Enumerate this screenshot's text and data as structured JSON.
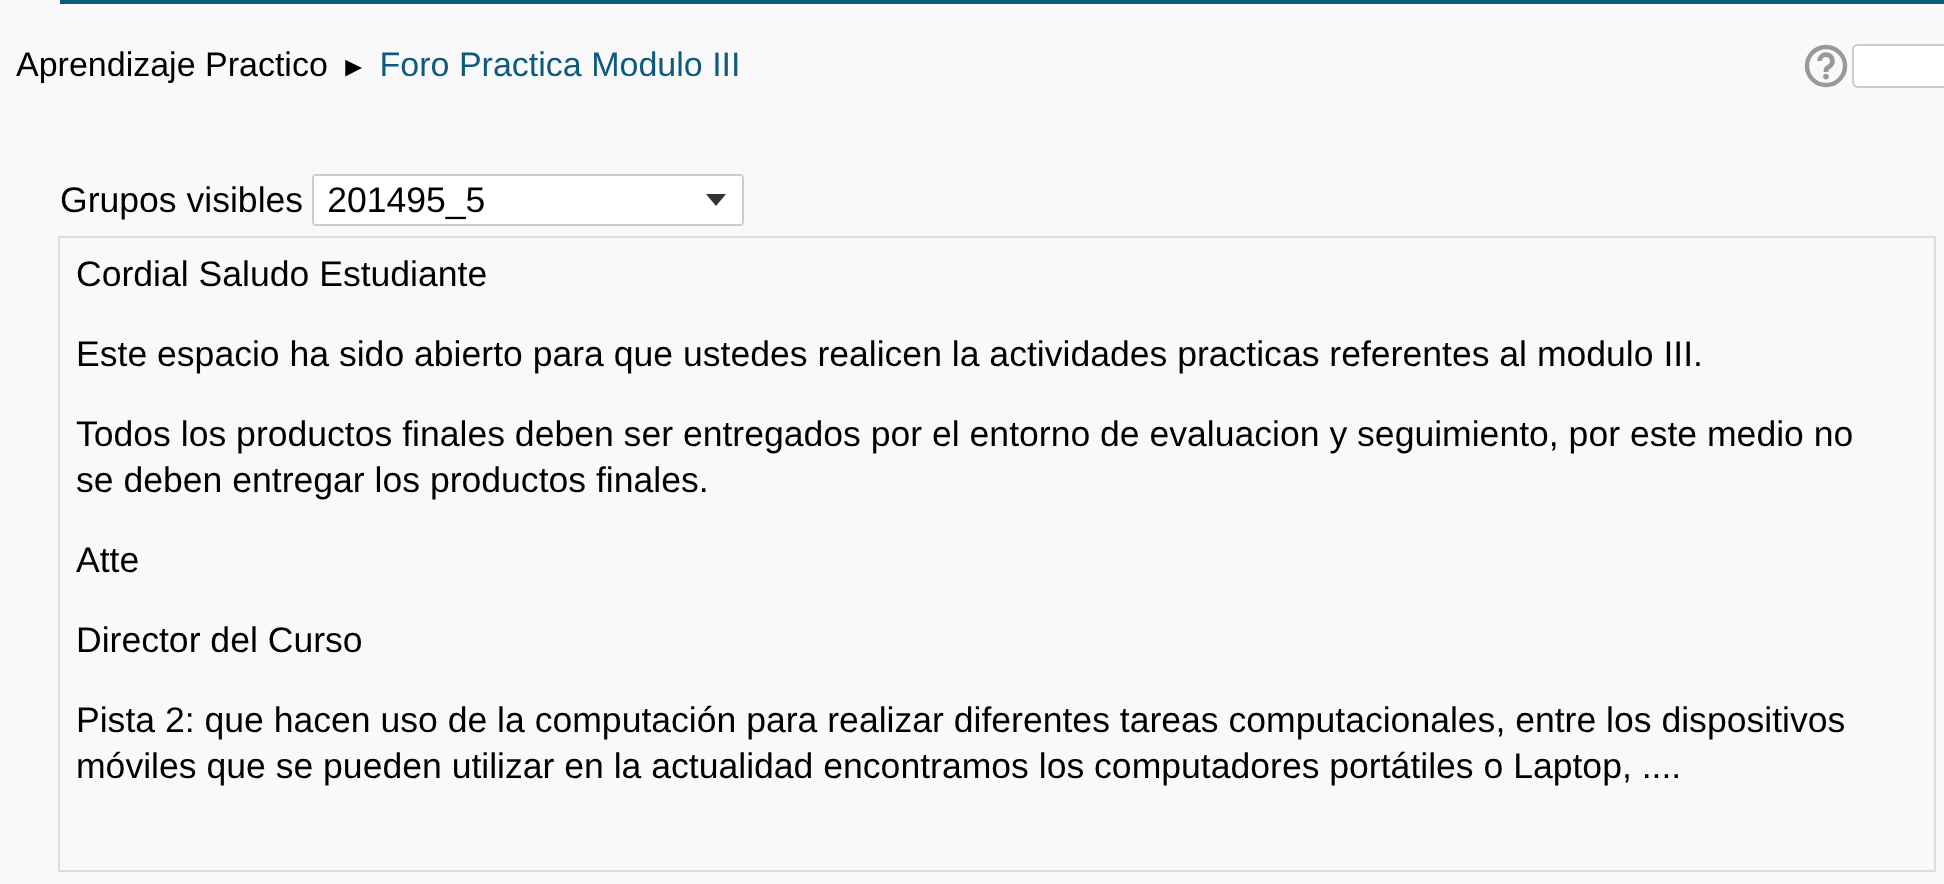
{
  "breadcrumb": [
    {
      "label": "Aprendizaje Practico",
      "kind": "text"
    },
    {
      "label": "►",
      "kind": "separator"
    },
    {
      "label": "Foro Practica Modulo III",
      "kind": "link"
    }
  ],
  "group_select": {
    "label": "Grupos visibles",
    "value": "201495_5"
  },
  "message": {
    "paragraphs": [
      "Cordial Saludo Estudiante",
      "Este espacio ha sido abierto para que ustedes realicen la actividades practicas referentes al modulo III.",
      "Todos los productos finales deben ser entregados por el entorno de evaluacion y seguimiento, por este medio no se deben entregar los productos finales.",
      "Atte",
      "Director del Curso",
      "Pista 2: que hacen uso de la computación para realizar diferentes tareas computacionales, entre los dispositivos móviles que se pueden utilizar en la actualidad encontramos los computadores portátiles o Laptop, ...."
    ]
  }
}
